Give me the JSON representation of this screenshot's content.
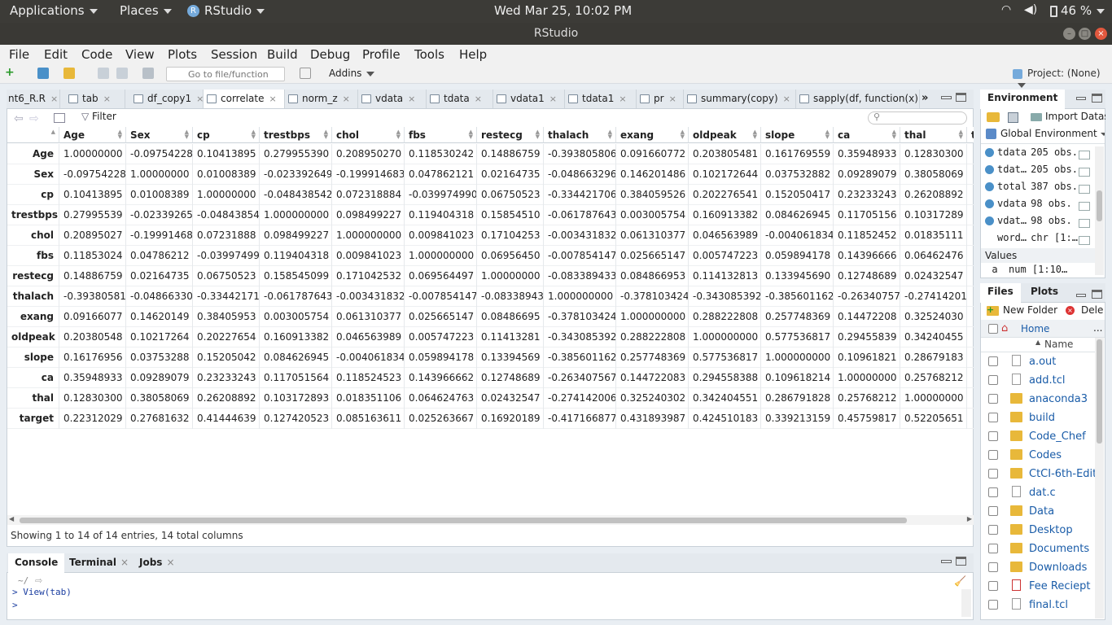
{
  "system": {
    "applications": "Applications",
    "places": "Places",
    "app_name": "RStudio",
    "clock": "Wed Mar 25, 10:02 PM",
    "battery": "46 %",
    "window_title": "RStudio"
  },
  "menu": [
    "File",
    "Edit",
    "Code",
    "View",
    "Plots",
    "Session",
    "Build",
    "Debug",
    "Profile",
    "Tools",
    "Help"
  ],
  "toolbar": {
    "goto_placeholder": "Go to file/function",
    "addins": "Addins",
    "project": "Project: (None)"
  },
  "editor_tabs": [
    "nt6_R.R",
    "tab",
    "df_copy1",
    "correlate",
    "norm_z",
    "vdata",
    "tdata",
    "vdata1",
    "tdata1",
    "pr",
    "summary(copy)",
    "sapply(df, function(x) su"
  ],
  "active_tab": "correlate",
  "filter_label": "Filter",
  "columns": [
    "Age",
    "Sex",
    "cp",
    "trestbps",
    "chol",
    "fbs",
    "restecg",
    "thalach",
    "exang",
    "oldpeak",
    "slope",
    "ca",
    "thal",
    "t"
  ],
  "rows": [
    {
      "name": "Age",
      "values": [
        "1.00000000",
        "-0.09754228",
        "0.10413895",
        "0.279955390",
        "0.208950270",
        "0.118530242",
        "0.14886759",
        "-0.393805806",
        "0.091660772",
        "0.203805481",
        "0.161769559",
        "0.35948933",
        "0.12830300"
      ]
    },
    {
      "name": "Sex",
      "values": [
        "-0.09754228",
        "1.00000000",
        "0.01008389",
        "-0.023392649",
        "-0.199914683",
        "0.047862121",
        "0.02164735",
        "-0.048663296",
        "0.146201486",
        "0.102172644",
        "0.037532882",
        "0.09289079",
        "0.38058069"
      ]
    },
    {
      "name": "cp",
      "values": [
        "0.10413895",
        "0.01008389",
        "1.00000000",
        "-0.048438542",
        "0.072318884",
        "-0.039974990",
        "0.06750523",
        "-0.334421706",
        "0.384059526",
        "0.202276541",
        "0.152050417",
        "0.23233243",
        "0.26208892"
      ]
    },
    {
      "name": "trestbps",
      "values": [
        "0.27995539",
        "-0.02339265",
        "-0.04843854",
        "1.000000000",
        "0.098499227",
        "0.119404318",
        "0.15854510",
        "-0.061787643",
        "0.003005754",
        "0.160913382",
        "0.084626945",
        "0.11705156",
        "0.10317289"
      ]
    },
    {
      "name": "chol",
      "values": [
        "0.20895027",
        "-0.19991468",
        "0.07231888",
        "0.098499227",
        "1.000000000",
        "0.009841023",
        "0.17104253",
        "-0.003431832",
        "0.061310377",
        "0.046563989",
        "-0.004061834",
        "0.11852452",
        "0.01835111"
      ]
    },
    {
      "name": "fbs",
      "values": [
        "0.11853024",
        "0.04786212",
        "-0.03997499",
        "0.119404318",
        "0.009841023",
        "1.000000000",
        "0.06956450",
        "-0.007854147",
        "0.025665147",
        "0.005747223",
        "0.059894178",
        "0.14396666",
        "0.06462476"
      ]
    },
    {
      "name": "restecg",
      "values": [
        "0.14886759",
        "0.02164735",
        "0.06750523",
        "0.158545099",
        "0.171042532",
        "0.069564497",
        "1.00000000",
        "-0.083389433",
        "0.084866953",
        "0.114132813",
        "0.133945690",
        "0.12748689",
        "0.02432547"
      ]
    },
    {
      "name": "thalach",
      "values": [
        "-0.39380581",
        "-0.04866330",
        "-0.33442171",
        "-0.061787643",
        "-0.003431832",
        "-0.007854147",
        "-0.08338943",
        "1.000000000",
        "-0.378103424",
        "-0.343085392",
        "-0.385601162",
        "-0.26340757",
        "-0.27414201"
      ]
    },
    {
      "name": "exang",
      "values": [
        "0.09166077",
        "0.14620149",
        "0.38405953",
        "0.003005754",
        "0.061310377",
        "0.025665147",
        "0.08486695",
        "-0.378103424",
        "1.000000000",
        "0.288222808",
        "0.257748369",
        "0.14472208",
        "0.32524030"
      ]
    },
    {
      "name": "oldpeak",
      "values": [
        "0.20380548",
        "0.10217264",
        "0.20227654",
        "0.160913382",
        "0.046563989",
        "0.005747223",
        "0.11413281",
        "-0.343085392",
        "0.288222808",
        "1.000000000",
        "0.577536817",
        "0.29455839",
        "0.34240455"
      ]
    },
    {
      "name": "slope",
      "values": [
        "0.16176956",
        "0.03753288",
        "0.15205042",
        "0.084626945",
        "-0.004061834",
        "0.059894178",
        "0.13394569",
        "-0.385601162",
        "0.257748369",
        "0.577536817",
        "1.000000000",
        "0.10961821",
        "0.28679183"
      ]
    },
    {
      "name": "ca",
      "values": [
        "0.35948933",
        "0.09289079",
        "0.23233243",
        "0.117051564",
        "0.118524523",
        "0.143966662",
        "0.12748689",
        "-0.263407567",
        "0.144722083",
        "0.294558388",
        "0.109618214",
        "1.00000000",
        "0.25768212"
      ]
    },
    {
      "name": "thal",
      "values": [
        "0.12830300",
        "0.38058069",
        "0.26208892",
        "0.103172893",
        "0.018351106",
        "0.064624763",
        "0.02432547",
        "-0.274142006",
        "0.325240302",
        "0.342404551",
        "0.286791828",
        "0.25768212",
        "1.00000000"
      ]
    },
    {
      "name": "target",
      "values": [
        "0.22312029",
        "0.27681632",
        "0.41444639",
        "0.127420523",
        "0.085163611",
        "0.025263667",
        "0.16920189",
        "-0.417166877",
        "0.431893987",
        "0.424510183",
        "0.339213159",
        "0.45759817",
        "0.52205651"
      ]
    }
  ],
  "status_text": "Showing 1 to 14 of 14 entries, 14 total columns",
  "console": {
    "tabs": [
      "Console",
      "Terminal",
      "Jobs"
    ],
    "path": "~/",
    "lines": [
      "> View(tab)",
      ">"
    ]
  },
  "environment": {
    "tabs": [
      "Environment"
    ],
    "import_label": "Import Datas",
    "scope": "Global Environment",
    "items": [
      {
        "name": "tdata",
        "value": "205 obs."
      },
      {
        "name": "tdat…",
        "value": "205 obs."
      },
      {
        "name": "total",
        "value": "387 obs."
      },
      {
        "name": "vdata",
        "value": "98 obs."
      },
      {
        "name": "vdat…",
        "value": "98 obs."
      },
      {
        "name": "word…",
        "value": "chr [1:…"
      }
    ],
    "values_header": "Values",
    "values": [
      {
        "name": "a",
        "value": "num [1:10…"
      }
    ]
  },
  "files": {
    "tabs": [
      "Files",
      "Plots"
    ],
    "new_folder": "New Folder",
    "delete": "Dele",
    "breadcrumb": "Home",
    "more": "...",
    "name_header": "Name",
    "items": [
      {
        "name": "a.out",
        "type": "doc"
      },
      {
        "name": "add.tcl",
        "type": "doc"
      },
      {
        "name": "anaconda3",
        "type": "folder"
      },
      {
        "name": "build",
        "type": "folder"
      },
      {
        "name": "Code_Chef",
        "type": "folder"
      },
      {
        "name": "Codes",
        "type": "folder"
      },
      {
        "name": "CtCI-6th-Edit…",
        "type": "folder"
      },
      {
        "name": "dat.c",
        "type": "doc"
      },
      {
        "name": "Data",
        "type": "folder"
      },
      {
        "name": "Desktop",
        "type": "folder"
      },
      {
        "name": "Documents",
        "type": "folder"
      },
      {
        "name": "Downloads",
        "type": "folder"
      },
      {
        "name": "Fee Reciept …",
        "type": "pdf"
      },
      {
        "name": "final.tcl",
        "type": "doc"
      }
    ]
  }
}
